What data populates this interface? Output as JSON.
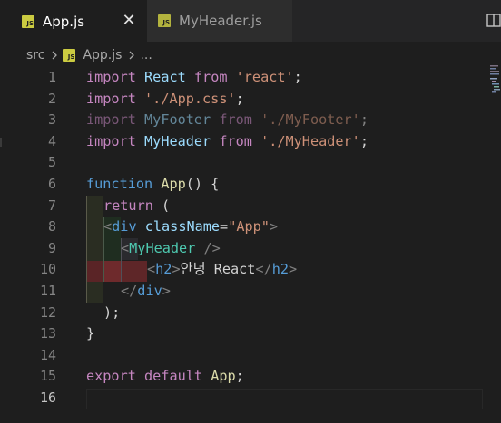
{
  "tabs": [
    {
      "label": "App.js",
      "active": true
    },
    {
      "label": "MyHeader.js",
      "active": false
    }
  ],
  "tab_close_symbol": "✕",
  "breadcrumb": {
    "folder": "src",
    "file": "App.js",
    "rest": "..."
  },
  "line_numbers": [
    "1",
    "2",
    "3",
    "4",
    "5",
    "6",
    "7",
    "8",
    "9",
    "10",
    "11",
    "12",
    "13",
    "14",
    "15",
    "16"
  ],
  "code": {
    "l1": {
      "kw": "import",
      "name": "React",
      "from": "from",
      "src": "'react'",
      "end": ";"
    },
    "l2": {
      "kw": "import",
      "src": "'./App.css'",
      "end": ";"
    },
    "l3": {
      "kw": "import",
      "name": "MyFooter",
      "from": "from",
      "src": "'./MyFooter'",
      "end": ";"
    },
    "l4": {
      "kw": "import",
      "name": "MyHeader",
      "from": "from",
      "src": "'./MyHeader'",
      "end": ";"
    },
    "l6": {
      "kw": "function",
      "name": "App",
      "rest": "() {"
    },
    "l7": {
      "kw": "return",
      "rest": " ("
    },
    "l8": {
      "open": "<",
      "tag": "div",
      "attr": "className",
      "eq": "=",
      "val": "\"App\"",
      "close": ">"
    },
    "l9": {
      "open": "<",
      "comp": "MyHeader",
      "close": " />"
    },
    "l10": {
      "open": "<",
      "tag": "h2",
      "close": ">",
      "text": "안녕 React",
      "open2": "</",
      "tag2": "h2",
      "close2": ">"
    },
    "l11": {
      "open": "</",
      "tag": "div",
      "close": ">"
    },
    "l12": {
      "text": ");"
    },
    "l13": {
      "text": "}"
    },
    "l15": {
      "kw": "export",
      "kw2": "default",
      "name": "App",
      "end": ";"
    }
  },
  "colors": {
    "keyword": "#c586c0",
    "storage": "#569cd6",
    "variable": "#9cdcfe",
    "string": "#ce9178",
    "function": "#dcdcaa",
    "component": "#4ec9b0",
    "js_icon": "#cbcb41"
  },
  "icons": [
    "js-file-icon",
    "close-icon",
    "chevron-right-icon",
    "split-editor-icon",
    "minimap"
  ]
}
